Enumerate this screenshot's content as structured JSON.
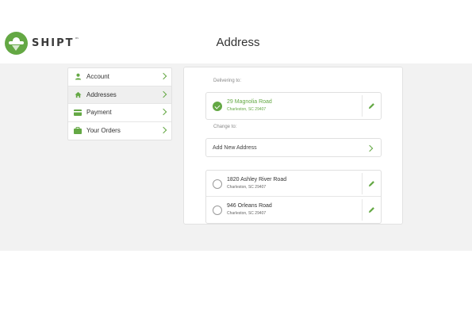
{
  "brand": {
    "name": "SHIPT",
    "trademark": "™",
    "color": "#64a844"
  },
  "header": {
    "title": "Address"
  },
  "sidebar": {
    "items": [
      {
        "label": "Account",
        "icon": "person-icon",
        "active": false
      },
      {
        "label": "Addresses",
        "icon": "house-icon",
        "active": true
      },
      {
        "label": "Payment",
        "icon": "credit-card-icon",
        "active": false
      },
      {
        "label": "Your Orders",
        "icon": "bag-icon",
        "active": false
      }
    ]
  },
  "delivering": {
    "label": "Delivering to:",
    "address": {
      "street": "29 Magnolia Road",
      "city": "Charleston, SC 29407",
      "selected": true
    }
  },
  "change": {
    "label": "Change to:",
    "add_label": "Add New Address",
    "addresses": [
      {
        "street": "1820 Ashley River Road",
        "city": "Charleston, SC 29407",
        "selected": false
      },
      {
        "street": "946 Orleans Road",
        "city": "Charleston, SC 29407",
        "selected": false
      }
    ]
  }
}
